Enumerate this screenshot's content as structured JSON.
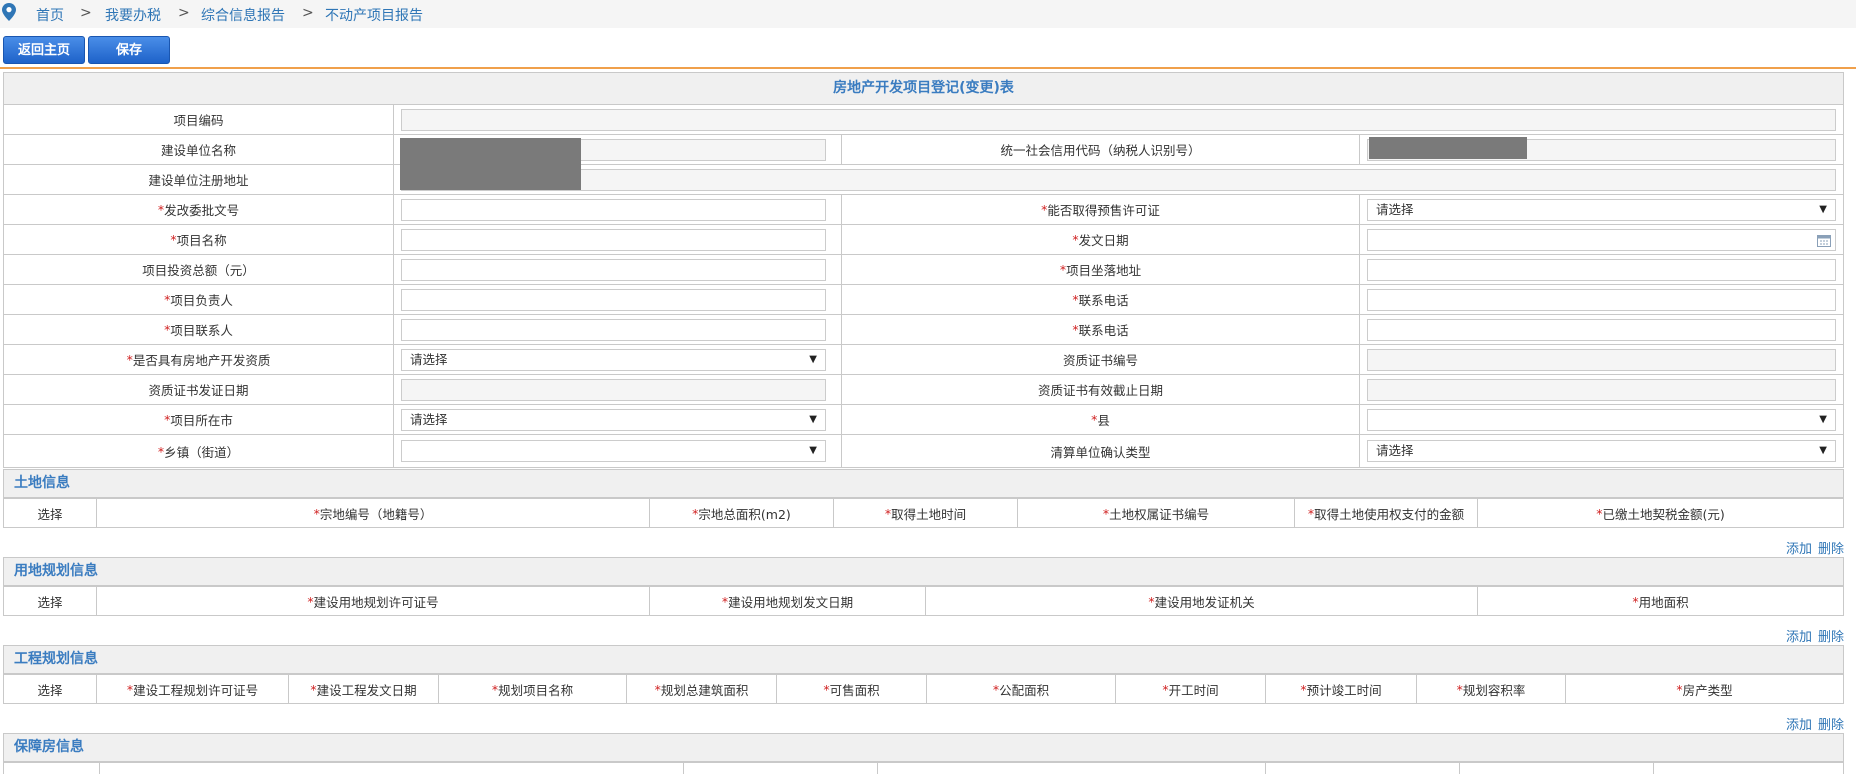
{
  "breadcrumb": [
    "首页",
    "我要办税",
    "综合信息报告",
    "不动产项目报告"
  ],
  "breadcrumb_sep": ">",
  "buttons": {
    "back": "返回主页",
    "save": "保存"
  },
  "form_title": "房地产开发项目登记(变更)表",
  "select_placeholder": "请选择",
  "fields": {
    "project_code": "项目编码",
    "builder_name": "建设单位名称",
    "credit_code": "统一社会信用代码（纳税人识别号）",
    "reg_address": "建设单位注册地址",
    "approval_no": "发改委批文号",
    "presale_permit": "能否取得预售许可证",
    "project_name": "项目名称",
    "issue_date": "发文日期",
    "total_investment": "项目投资总额（元）",
    "project_location": "项目坐落地址",
    "project_manager": "项目负责人",
    "phone1": "联系电话",
    "project_contact": "项目联系人",
    "phone2": "联系电话",
    "has_qualification": "是否具有房地产开发资质",
    "cert_no": "资质证书编号",
    "cert_issue_date": "资质证书发证日期",
    "cert_expire_date": "资质证书有效截止日期",
    "city": "项目所在市",
    "county": "县",
    "town": "乡镇（街道）",
    "settle_unit_type": "清算单位确认类型"
  },
  "sections": {
    "land": {
      "title": "土地信息",
      "columns": [
        "选择",
        "宗地编号（地籍号）",
        "宗地总面积(m2)",
        "取得土地时间",
        "土地权属证书编号",
        "取得土地使用权支付的金额",
        "已缴土地契税金额(元)"
      ]
    },
    "landplan": {
      "title": "用地规划信息",
      "columns": [
        "选择",
        "建设用地规划许可证号",
        "建设用地规划发文日期",
        "建设用地发证机关",
        "用地面积"
      ]
    },
    "engplan": {
      "title": "工程规划信息",
      "columns": [
        "选择",
        "建设工程规划许可证号",
        "建设工程发文日期",
        "规划项目名称",
        "规划总建筑面积",
        "可售面积",
        "公配面积",
        "开工时间",
        "预计竣工时间",
        "规划容积率",
        "房产类型"
      ]
    },
    "housing": {
      "title": "保障房信息"
    }
  },
  "actions": {
    "add": "添加",
    "delete": "删除"
  },
  "colors": {
    "accent": "#2f76b6",
    "button": "#1e62c9",
    "divider": "#f0a04b",
    "required": "#d02020"
  }
}
